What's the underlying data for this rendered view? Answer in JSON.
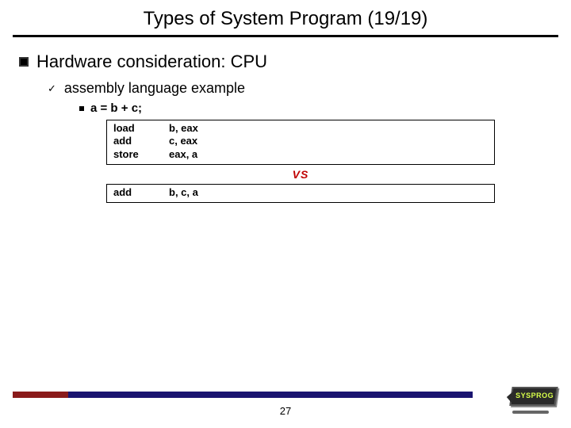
{
  "title": "Types of System Program (19/19)",
  "h1": "Hardware consideration: CPU",
  "h2": "assembly language example",
  "h3": "a = b + c;",
  "box1": {
    "l1m": "load",
    "l1o": "b, eax",
    "l2m": "add",
    "l2o": "c, eax",
    "l3m": "store",
    "l3o": "eax, a"
  },
  "vs": "VS",
  "box2": {
    "l1m": "add",
    "l1o": "b, c, a"
  },
  "page": "27",
  "logo": "SYSPROG"
}
